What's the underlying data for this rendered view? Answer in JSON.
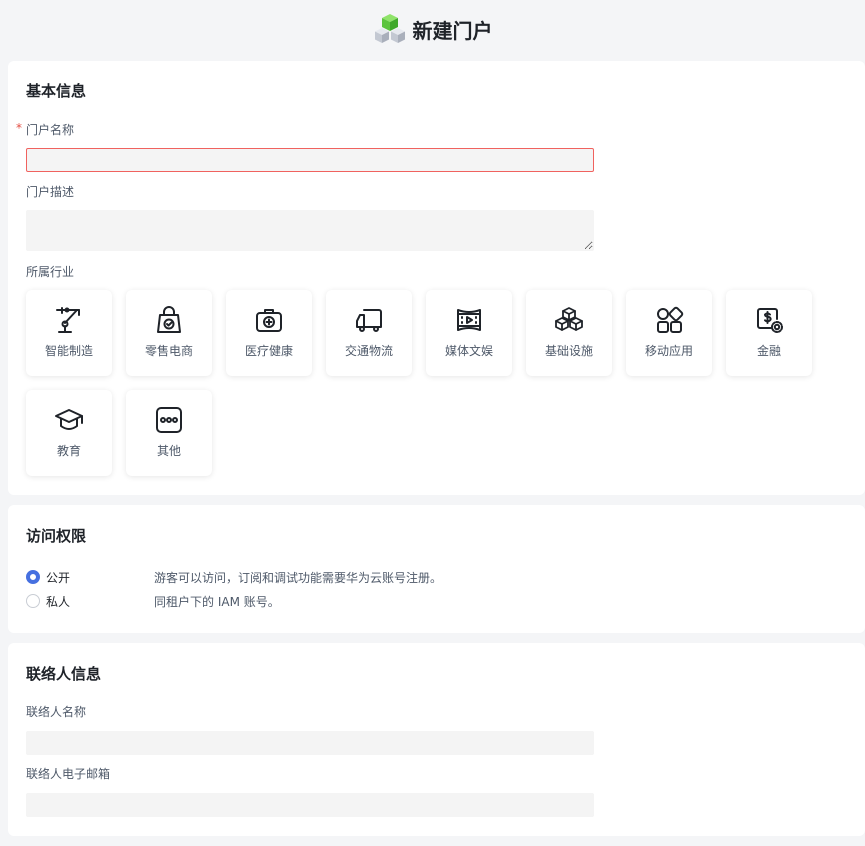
{
  "header": {
    "title": "新建门户",
    "logo_icon": "cubes-icon"
  },
  "basic": {
    "section_title": "基本信息",
    "name_label": "门户名称",
    "name_required": "*",
    "name_value": "",
    "desc_label": "门户描述",
    "desc_value": "",
    "industry_label": "所属行业",
    "industries": [
      {
        "label": "智能制造",
        "icon": "robot-arm-icon"
      },
      {
        "label": "零售电商",
        "icon": "shopping-bag-icon"
      },
      {
        "label": "医疗健康",
        "icon": "medical-kit-icon"
      },
      {
        "label": "交通物流",
        "icon": "truck-icon"
      },
      {
        "label": "媒体文娱",
        "icon": "video-reel-icon"
      },
      {
        "label": "基础设施",
        "icon": "infrastructure-cubes-icon"
      },
      {
        "label": "移动应用",
        "icon": "app-grid-icon"
      },
      {
        "label": "金融",
        "icon": "finance-dollar-icon"
      },
      {
        "label": "教育",
        "icon": "graduation-cap-icon"
      },
      {
        "label": "其他",
        "icon": "more-dots-icon"
      }
    ]
  },
  "access": {
    "section_title": "访问权限",
    "options": [
      {
        "label": "公开",
        "desc": "游客可以访问，订阅和调试功能需要华为云账号注册。",
        "checked": true
      },
      {
        "label": "私人",
        "desc": "同租户下的 IAM 账号。",
        "checked": false
      }
    ]
  },
  "contact": {
    "section_title": "联络人信息",
    "name_label": "联络人名称",
    "name_value": "",
    "email_label": "联络人电子邮箱",
    "email_value": ""
  },
  "colors": {
    "accent": "#4670e0",
    "error": "#f0625e",
    "required": "#e34d43",
    "background": "#f4f5f7"
  }
}
